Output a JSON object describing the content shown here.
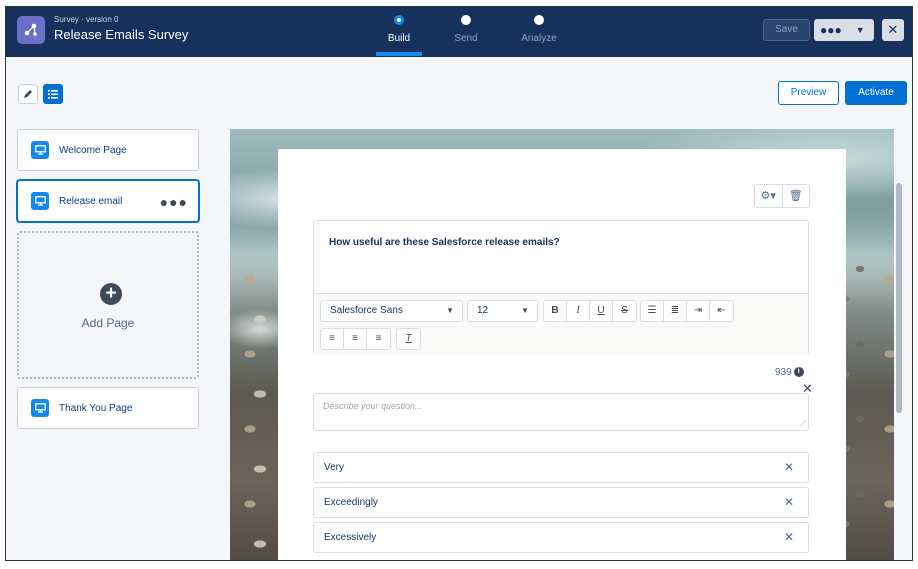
{
  "header": {
    "subtitle": "Survey · version 0",
    "title": "Release Emails Survey",
    "steps": [
      {
        "label": "Build",
        "active": true
      },
      {
        "label": "Send",
        "active": false
      },
      {
        "label": "Analyze",
        "active": false
      }
    ],
    "save_label": "Save",
    "more_label": "●●●",
    "close_label": "✕"
  },
  "toolbar": {
    "preview_label": "Preview",
    "activate_label": "Activate"
  },
  "sidebar": {
    "pages": [
      {
        "label": "Welcome Page"
      },
      {
        "label": "Release email",
        "selected": true
      },
      {
        "label": "Thank You Page"
      }
    ],
    "add_page_label": "Add Page",
    "dots_label": "●●●"
  },
  "question": {
    "text": "How useful are these Salesforce release emails?",
    "font": "Salesforce Sans",
    "size": "12",
    "char_count": "939",
    "description_placeholder": "Describe your question...",
    "choices": [
      "Very",
      "Exceedingly",
      "Excessively"
    ]
  },
  "colors": {
    "header_bg": "#16325c",
    "brand": "#0070d2",
    "accent": "#1589ee"
  }
}
